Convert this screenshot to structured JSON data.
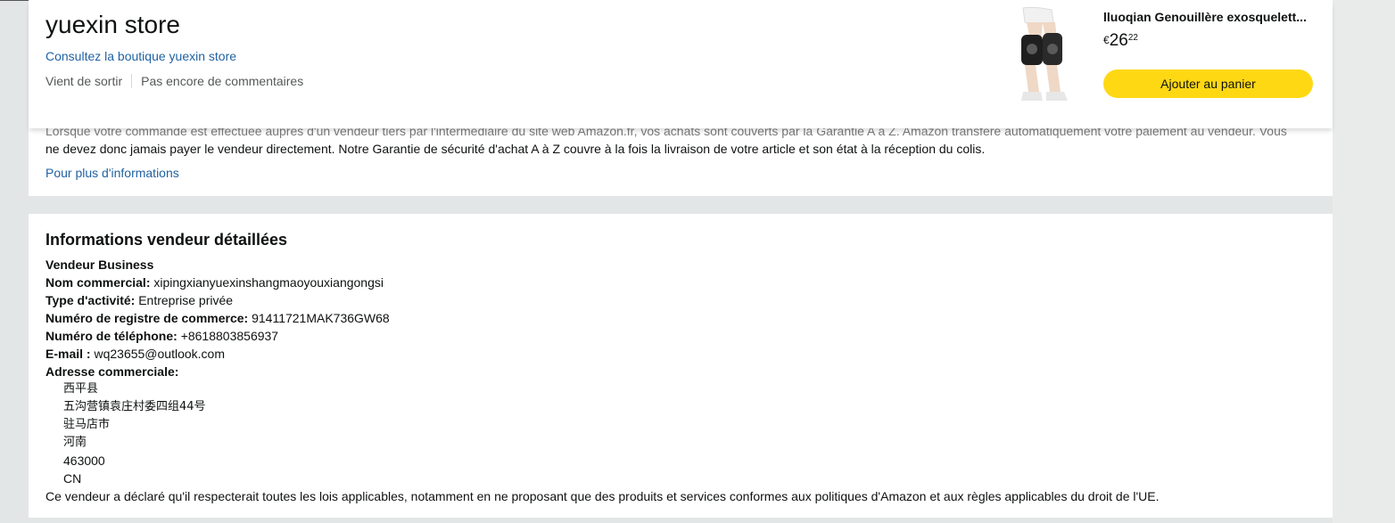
{
  "store": {
    "name": "yuexin store",
    "visit_link": "Consultez la boutique yuexin store",
    "status": "Vient de sortir",
    "reviews": "Pas encore de commentaires"
  },
  "product": {
    "title": "lluoqian Genouillère exosquelett...",
    "price_currency": "€",
    "price_whole": "26",
    "price_fraction": "22",
    "add_to_cart": "Ajouter au panier"
  },
  "guarantee": {
    "text_line1": "Lorsque votre commande est effectuée auprès d'un vendeur tiers par l'intermédiaire du site web Amazon.fr, vos achats sont couverts par la Garantie A à Z. Amazon transfère automatiquement votre paiement au vendeur. Vous",
    "text_line2": "ne devez donc jamais payer le vendeur directement. Notre Garantie de sécurité d'achat A à Z couvre à la fois la livraison de votre article et son état à la réception du colis.",
    "more_link": "Pour plus d'informations"
  },
  "seller": {
    "section_title": "Informations vendeur détaillées",
    "business_label": "Vendeur Business",
    "trade_name_label": "Nom commercial:",
    "trade_name": "xipingxianyuexinshangmaoyouxiangongsi",
    "activity_label": "Type d'activité:",
    "activity": "Entreprise privée",
    "registry_label": "Numéro de registre de commerce:",
    "registry": "91411721MAK736GW68",
    "phone_label": "Numéro de téléphone:",
    "phone": "+8618803856937",
    "email_label": "E-mail :",
    "email": "wq23655@outlook.com",
    "address_label": "Adresse commerciale:",
    "address": [
      "西平县",
      "五沟营镇袁庄村委四组44号",
      "驻马店市",
      "河南",
      "463000",
      "CN"
    ],
    "compliance": "Ce vendeur a déclaré qu'il respecterait toutes les lois applicables, notamment en ne proposant que des produits et services conformes aux politiques d'Amazon et aux règles applicables du droit de l'UE."
  }
}
